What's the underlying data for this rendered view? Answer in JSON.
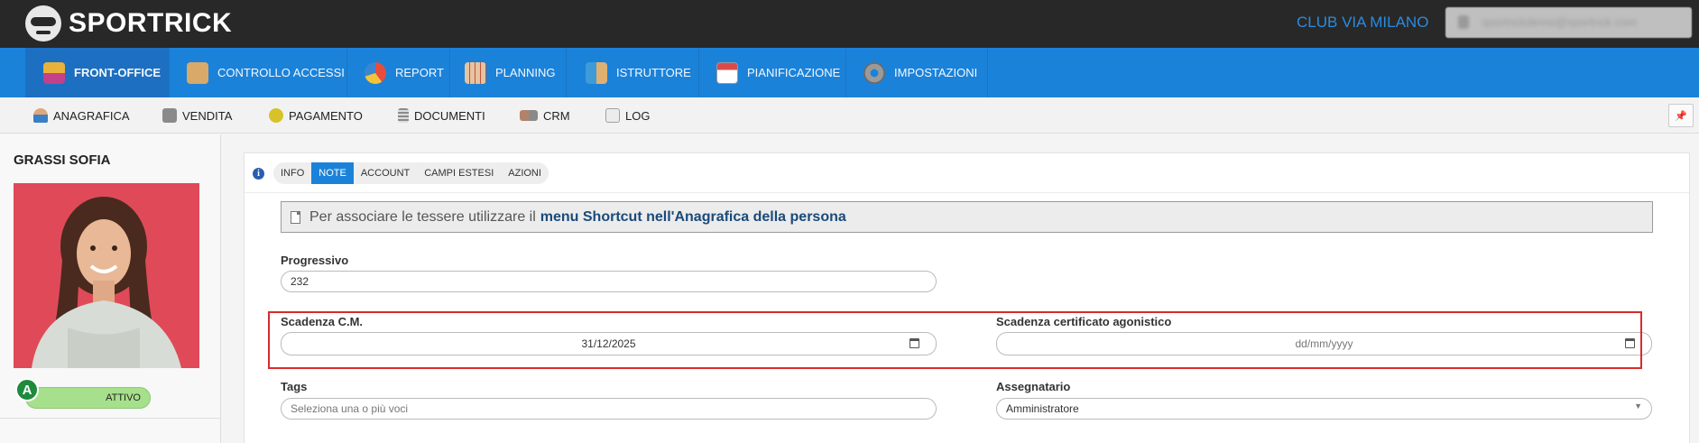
{
  "app": {
    "brand": "SPORTRICK",
    "club": "CLUB VIA MILANO",
    "user_email": "sportrickdemo@sportrick.com"
  },
  "main_nav": [
    {
      "label": "FRONT-OFFICE",
      "icon": "front-office-icon",
      "color": "#e8b23a"
    },
    {
      "label": "CONTROLLO ACCESSI",
      "icon": "access-control-icon",
      "color": "#d9a96a"
    },
    {
      "label": "REPORT",
      "icon": "pie-chart-icon",
      "color": "#e84c3d"
    },
    {
      "label": "PLANNING",
      "icon": "planning-calendar-icon",
      "color": "#e7c3a0"
    },
    {
      "label": "ISTRUTTORE",
      "icon": "instructor-icon",
      "color": "#3f9bd8"
    },
    {
      "label": "PIANIFICAZIONE",
      "icon": "calendar-icon",
      "color": "#d94b4b"
    },
    {
      "label": "IMPOSTAZIONI",
      "icon": "gear-icon",
      "color": "#9a9a9a"
    }
  ],
  "sub_nav": [
    {
      "label": "ANAGRAFICA",
      "icon": "person-icon",
      "color": "#3a7fc4"
    },
    {
      "label": "VENDITA",
      "icon": "cash-register-icon",
      "color": "#8a8a8a"
    },
    {
      "label": "PAGAMENTO",
      "icon": "coin-icon",
      "color": "#d8c22a"
    },
    {
      "label": "DOCUMENTI",
      "icon": "document-icon",
      "color": "#8a8a8a"
    },
    {
      "label": "CRM",
      "icon": "handshake-icon",
      "color": "#b0846a"
    },
    {
      "label": "LOG",
      "icon": "log-icon",
      "color": "#a0a0a0"
    }
  ],
  "sidebar": {
    "name": "GRASSI SOFIA",
    "status_letter": "A",
    "status_label": "ATTIVO"
  },
  "tabs": [
    "INFO",
    "NOTE",
    "ACCOUNT",
    "CAMPI ESTESI",
    "AZIONI"
  ],
  "active_tab": "NOTE",
  "notice": {
    "text": "Per associare le tessere utilizzare il",
    "link": "menu Shortcut nell'Anagrafica della persona"
  },
  "form": {
    "progressivo_label": "Progressivo",
    "progressivo_value": "232",
    "scadenza_cm_label": "Scadenza C.M.",
    "scadenza_cm_value": "31/12/2025",
    "scadenza_agonistico_label": "Scadenza certificato agonistico",
    "scadenza_agonistico_value": "dd/mm/yyyy",
    "tags_label": "Tags",
    "tags_placeholder": "Seleziona una o più voci",
    "assegnatario_label": "Assegnatario",
    "assegnatario_value": "Amministratore"
  },
  "colors": {
    "topbar": "#282828",
    "nav": "#1b82d9",
    "accent": "#1b82d9",
    "highlight": "#d92b2b",
    "status_green": "#a7e08c"
  }
}
